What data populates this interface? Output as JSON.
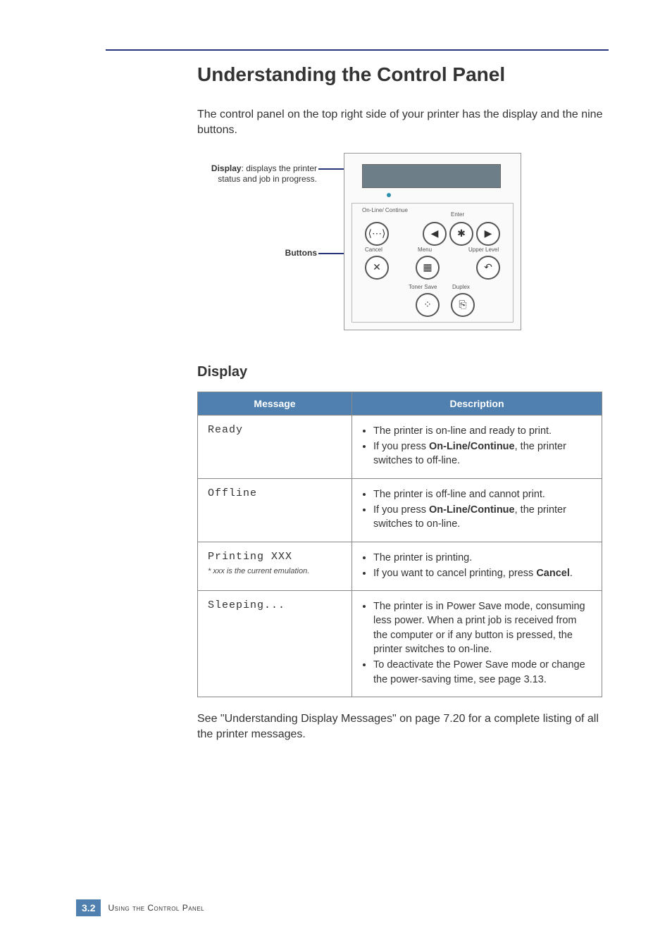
{
  "heading": "Understanding the Control Panel",
  "intro": "The control panel on the top right side of your printer has the display and the nine buttons.",
  "figure": {
    "display_callout_bold": "Display",
    "display_callout_rest": ": displays the printer status and job in progress.",
    "buttons_callout": "Buttons",
    "panel_labels": {
      "online": "On-Line/\nContinue",
      "enter": "Enter",
      "cancel": "Cancel",
      "menu": "Menu",
      "upper": "Upper Level",
      "toner": "Toner Save",
      "duplex": "Duplex"
    },
    "glyphs": {
      "online": "⟨⋯⟩",
      "left": "◀",
      "enter": "✱",
      "right": "▶",
      "cancel": "✕",
      "menu": "▦",
      "upper": "↶",
      "toner": "⁘",
      "duplex": "⎘"
    }
  },
  "subhead": "Display",
  "table": {
    "head_message": "Message",
    "head_description": "Description",
    "rows": [
      {
        "msg": "Ready",
        "footnote": "",
        "bullets": [
          "The printer is on-line and ready to print.",
          "If you press <b>On-Line/Continue</b>, the printer switches to off-line."
        ]
      },
      {
        "msg": "Offline",
        "footnote": "",
        "bullets": [
          "The printer is off-line and cannot print.",
          "If you press <b>On-Line/Continue</b>, the printer switches to on-line."
        ]
      },
      {
        "msg": "Printing XXX",
        "footnote": "* xxx is the current emulation.",
        "bullets": [
          "The printer is printing.",
          "If you want to cancel printing, press <b>Cancel</b>."
        ]
      },
      {
        "msg": "Sleeping...",
        "footnote": "",
        "bullets": [
          "The printer is in Power Save mode, consuming less power. When a print job is received from the computer or if any button is pressed, the printer switches to on-line.",
          "To deactivate the Power Save mode or change the power-saving time, see page 3.13."
        ]
      }
    ]
  },
  "after_table": "See \"Understanding Display Messages\" on page 7.20 for a complete listing of all the printer messages.",
  "footer": {
    "chapter": "3.",
    "page": "2",
    "text": "Using the Control Panel"
  }
}
